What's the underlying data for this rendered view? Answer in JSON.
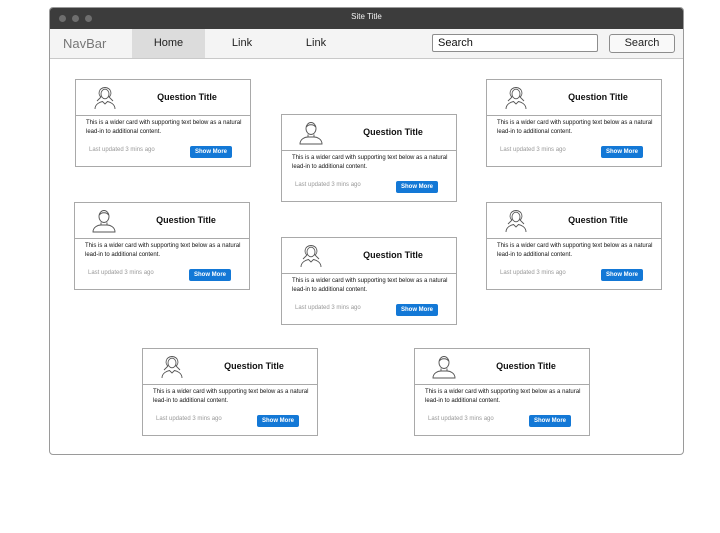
{
  "window": {
    "title": "Site Title"
  },
  "navbar": {
    "brand": "NavBar",
    "links": [
      "Home",
      "Link",
      "Link"
    ],
    "active_index": 0,
    "search_value": "Search",
    "search_button": "Search"
  },
  "cards": [
    {
      "title": "Question Title",
      "text": "This is a wider card with supporting text below as a natural lead-in to additional content.",
      "updated": "Last updated 3 mins ago",
      "button": "Show More",
      "avatar": "female-user-icon"
    },
    {
      "title": "Question Title",
      "text": "This is a wider card with supporting text below as a natural lead-in to additional content.",
      "updated": "Last updated 3 mins ago",
      "button": "Show More",
      "avatar": "male-user-icon"
    },
    {
      "title": "Question Title",
      "text": "This is a wider card with supporting text below as a natural lead-in to additional content.",
      "updated": "Last updated 3 mins ago",
      "button": "Show More",
      "avatar": "female-user-icon"
    },
    {
      "title": "Question Title",
      "text": "This is a wider card with supporting text below as a natural lead-in to additional content.",
      "updated": "Last updated 3 mins ago",
      "button": "Show More",
      "avatar": "male-user-icon"
    },
    {
      "title": "Question Title",
      "text": "This is a wider card with supporting text below as a natural lead-in to additional content.",
      "updated": "Last updated 3 mins ago",
      "button": "Show More",
      "avatar": "female-user-icon"
    },
    {
      "title": "Question Title",
      "text": "This is a wider card with supporting text below as a natural lead-in to additional content.",
      "updated": "Last updated 3 mins ago",
      "button": "Show More",
      "avatar": "female-user-icon"
    },
    {
      "title": "Question Title",
      "text": "This is a wider card with supporting text below as a natural lead-in to additional content.",
      "updated": "Last updated 3 mins ago",
      "button": "Show More",
      "avatar": "female-user-icon"
    },
    {
      "title": "Question Title",
      "text": "This is a wider card with supporting text below as a natural lead-in to additional content.",
      "updated": "Last updated 3 mins ago",
      "button": "Show More",
      "avatar": "male-user-icon"
    }
  ]
}
